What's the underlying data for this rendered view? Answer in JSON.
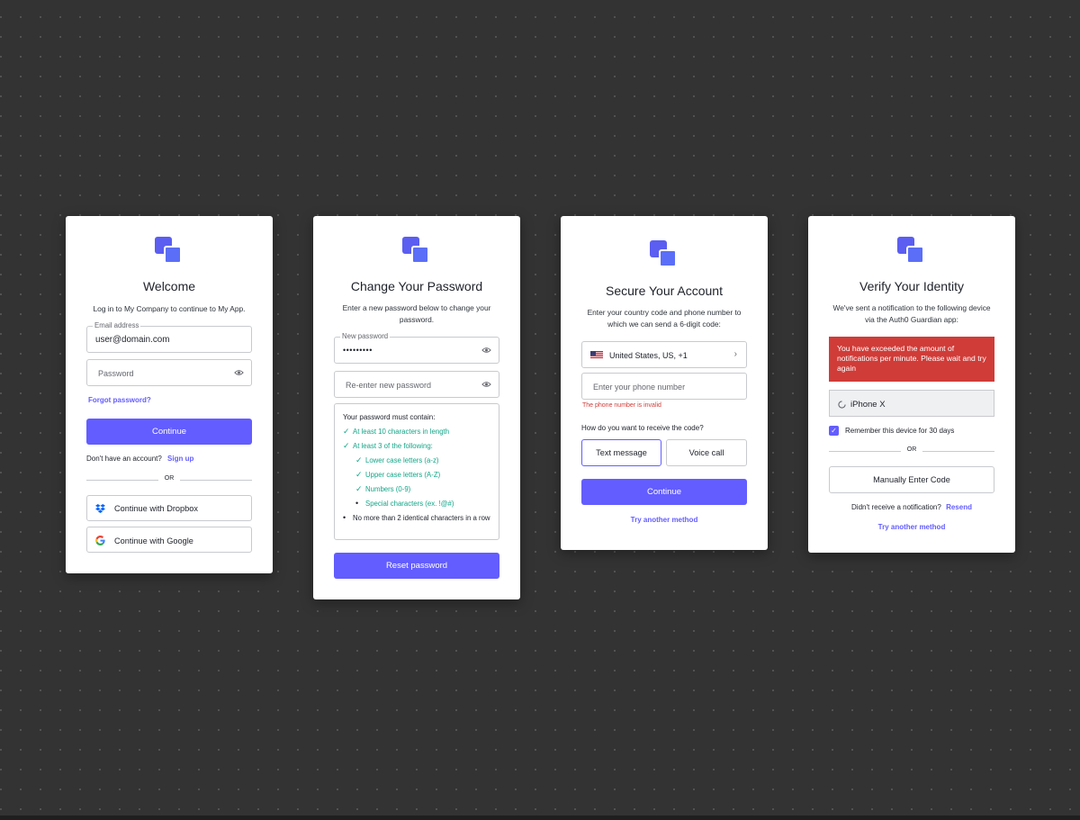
{
  "colors": {
    "background": "#333333",
    "accent": "#635dff",
    "error": "#d03c38",
    "success": "#13a688"
  },
  "login": {
    "title": "Welcome",
    "description": "Log in to My Company to continue to My App.",
    "email_label": "Email address",
    "email_value": "user@domain.com",
    "password_placeholder": "Password",
    "forgot_password": "Forgot password?",
    "continue_label": "Continue",
    "no_account_text": "Don't have an account?",
    "signup_link": "Sign up",
    "or_text": "OR",
    "dropbox_label": "Continue with Dropbox",
    "google_label": "Continue with Google",
    "icons": [
      "logo-icon",
      "eye-icon",
      "dropbox-icon",
      "google-icon"
    ]
  },
  "change_password": {
    "title": "Change Your Password",
    "description": "Enter a new password below to change your password.",
    "new_password_label": "New password",
    "new_password_value": "•••••••••",
    "reenter_placeholder": "Re-enter new password",
    "requirements_heading": "Your password must contain:",
    "requirements": [
      {
        "text": "At least 10 characters in length",
        "met": true
      },
      {
        "text": "At least 3 of the following:",
        "met": true
      },
      {
        "text": "Lower case letters (a-z)",
        "met": true
      },
      {
        "text": "Upper case letters (A-Z)",
        "met": true
      },
      {
        "text": "Numbers (0-9)",
        "met": true
      },
      {
        "text": "Special characters (ex. !@#)",
        "met": false
      },
      {
        "text": "No more than 2 identical characters in a row",
        "met": false
      }
    ],
    "reset_label": "Reset password"
  },
  "secure_account": {
    "title": "Secure Your Account",
    "description": "Enter your country code and phone number to which we can send a 6-digit code:",
    "country_value": "United States, US, +1",
    "phone_placeholder": "Enter your phone number",
    "phone_error": "The phone number is invalid",
    "receive_question": "How do you want to receive the code?",
    "text_message_label": "Text message",
    "voice_call_label": "Voice call",
    "continue_label": "Continue",
    "try_another": "Try another method"
  },
  "verify_identity": {
    "title": "Verify Your Identity",
    "description": "We've sent a notification to the following device via the Auth0 Guardian app:",
    "error_message": "You have exceeded the amount of notifications per minute. Please wait and try again",
    "device_name": "iPhone X",
    "remember_label": "Remember this device for 30 days",
    "remember_checked": true,
    "or_text": "OR",
    "manual_code_label": "Manually Enter Code",
    "didnt_receive": "Didn't receive a notification?",
    "resend_link": "Resend",
    "try_another": "Try another method"
  }
}
